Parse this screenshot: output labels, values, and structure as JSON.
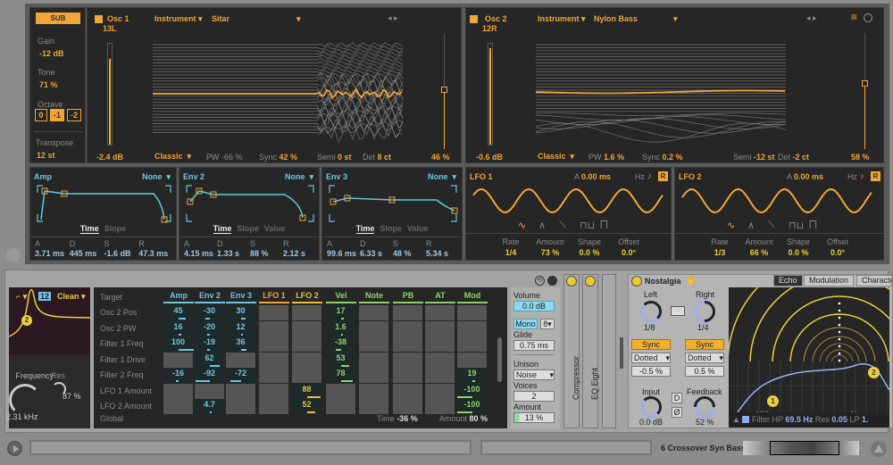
{
  "sub": {
    "label": "SUB",
    "gain_label": "Gain",
    "gain": "-12 dB",
    "tone_label": "Tone",
    "tone": "71 %",
    "octave_label": "Octave",
    "octaves": [
      "0",
      "-1",
      "-2"
    ],
    "octave_selected": "-1",
    "transpose_label": "Transpose",
    "transpose": "12 st"
  },
  "osc1": {
    "title": "Osc 1",
    "pan": "13L",
    "category": "Instrument",
    "wavetable": "Sitar",
    "gain": "-2.4 dB",
    "mode": "Classic",
    "pw_label": "PW",
    "pw": "-66 %",
    "sync_label": "Sync",
    "sync": "42 %",
    "semi_label": "Semi",
    "semi": "0 st",
    "det_label": "Det",
    "det": "8 ct",
    "position": "46 %"
  },
  "osc2": {
    "title": "Osc 2",
    "pan": "12R",
    "category": "Instrument",
    "wavetable": "Nylon Bass",
    "gain": "-0.6 dB",
    "mode": "Classic",
    "pw_label": "PW",
    "pw": "1.6 %",
    "sync_label": "Sync",
    "sync": "0.2 %",
    "semi_label": "Semi",
    "semi": "-12 st",
    "det_label": "Det",
    "det": "-2 ct",
    "position": "58 %"
  },
  "envs": [
    {
      "title": "Amp",
      "target": "None",
      "tabs": [
        "Time",
        "Slope"
      ],
      "a": "3.71 ms",
      "d": "445 ms",
      "s": "-1.6 dB",
      "r": "47.3 ms"
    },
    {
      "title": "Env 2",
      "target": "None",
      "tabs": [
        "Time",
        "Slope",
        "Value"
      ],
      "a": "4.15 ms",
      "d": "1.33 s",
      "s": "88 %",
      "r": "2.12 s"
    },
    {
      "title": "Env 3",
      "target": "None",
      "tabs": [
        "Time",
        "Slope",
        "Value"
      ],
      "a": "99.6 ms",
      "d": "6.33 s",
      "s": "48 %",
      "r": "5.34 s"
    }
  ],
  "adsr_labels": [
    "A",
    "D",
    "S",
    "R"
  ],
  "lfos": [
    {
      "title": "LFO 1",
      "a_label": "A",
      "attack": "0.00 ms",
      "hz": "Hz",
      "r": "R",
      "rate": "1/4",
      "amount": "73 %",
      "shape": "0.0 %",
      "offset": "0.0°"
    },
    {
      "title": "LFO 2",
      "a_label": "A",
      "attack": "0.00 ms",
      "hz": "Hz",
      "r": "R",
      "rate": "1/3",
      "amount": "66 %",
      "shape": "0.0 %",
      "offset": "0.0°"
    }
  ],
  "lfo_param_labels": [
    "Rate",
    "Amount",
    "Shape",
    "Offset"
  ],
  "filter": {
    "slope": "12",
    "circuit": "Clean",
    "frequency_label": "Frequency",
    "frequency": "2.31 kHz",
    "res_label": "Res",
    "res": "87 %",
    "node": "2"
  },
  "matrix": {
    "target_label": "Target",
    "columns": [
      {
        "name": "Amp",
        "color": "#6ec6e6"
      },
      {
        "name": "Env 2",
        "color": "#6ec6e6"
      },
      {
        "name": "Env 3",
        "color": "#6ec6e6"
      },
      {
        "name": "LFO 1",
        "color": "#f0a537"
      },
      {
        "name": "LFO 2",
        "color": "#e8c040"
      },
      {
        "name": "Vel",
        "color": "#8fd16a"
      },
      {
        "name": "Note",
        "color": "#8fd16a"
      },
      {
        "name": "PB",
        "color": "#8fd16a"
      },
      {
        "name": "AT",
        "color": "#8fd16a"
      },
      {
        "name": "Mod",
        "color": "#8fd16a"
      }
    ],
    "rows": [
      {
        "target": "Osc 2 Pos",
        "values": [
          "45",
          "-30",
          "30",
          null,
          null,
          "17",
          null,
          null,
          null,
          null
        ]
      },
      {
        "target": "Osc 2 PW",
        "values": [
          "16",
          "-20",
          "12",
          null,
          null,
          "1.6",
          null,
          null,
          null,
          null
        ]
      },
      {
        "target": "Filter 1 Freq",
        "values": [
          "100",
          "-19",
          "36",
          null,
          null,
          "-38",
          null,
          null,
          null,
          null
        ]
      },
      {
        "target": "Filter 1 Drive",
        "values": [
          null,
          "62",
          null,
          null,
          null,
          "53",
          null,
          null,
          null,
          null
        ]
      },
      {
        "target": "Filter 2 Freq",
        "values": [
          "-16",
          "-92",
          "-72",
          null,
          null,
          "78",
          null,
          null,
          null,
          "19"
        ]
      },
      {
        "target": "LFO 1 Amount",
        "values": [
          null,
          null,
          null,
          null,
          "88",
          null,
          null,
          null,
          null,
          "-100"
        ]
      },
      {
        "target": "LFO 2 Amount",
        "values": [
          null,
          "4.7",
          null,
          null,
          "52",
          null,
          null,
          null,
          null,
          "-100"
        ]
      }
    ],
    "global_label": "Global",
    "time_label": "Time",
    "time": "-36 %",
    "amount_label": "Amount",
    "amount": "80 %"
  },
  "global": {
    "volume_label": "Volume",
    "volume": "0.0 dB",
    "mono": "Mono",
    "voices_poly": "8",
    "glide_label": "Glide",
    "glide": "0.75 ms",
    "unison_label": "Unison",
    "unison": "Noise",
    "voices_label": "Voices",
    "voices": "2",
    "amount_label": "Amount",
    "amount": "13 %",
    "amount_fraction": 0.13
  },
  "chain": [
    "Compressor",
    "EQ Eight"
  ],
  "nostalgia": {
    "title": "Nostalgia",
    "tabs": [
      "Echo",
      "Modulation",
      "Character"
    ],
    "active_tab": "Echo",
    "left_label": "Left",
    "left": "1/8",
    "right_label": "Right",
    "right": "1/4",
    "sync": "Sync",
    "mode": "Dotted",
    "left_offset": "-0.5 %",
    "right_offset": "0.5 %",
    "input_label": "Input",
    "input": "0.0 dB",
    "feedback_label": "Feedback",
    "feedback": "52 %",
    "d": "D",
    "phase": "Ø",
    "freq_100": "100",
    "freq_1k": "1k",
    "filter_label": "Filter",
    "hp_label": "HP",
    "hp": "69.5 Hz",
    "res_label": "Res",
    "res": "0.05",
    "lp_label": "LP",
    "lp": "1.",
    "node1": "1",
    "node2": "2"
  },
  "footer": {
    "track": "6 Crossover Syn Bass"
  },
  "colors": {
    "orange": "#f0a537",
    "blue": "#6ec6e6",
    "green": "#8fd16a",
    "yellow": "#e8d040",
    "panel": "#262626"
  }
}
